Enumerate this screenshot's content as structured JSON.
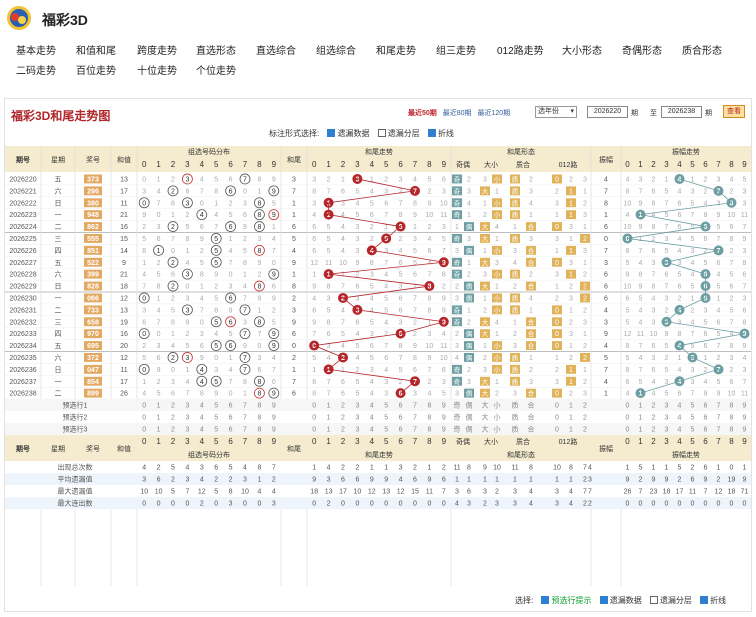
{
  "title": "福彩3D",
  "nav": [
    "基本走势",
    "和值和尾",
    "跨度走势",
    "直选形态",
    "直选综合",
    "组选综合",
    "和尾走势",
    "组三走势",
    "012路走势",
    "大小形态",
    "奇偶形态",
    "质合形态",
    "二码走势",
    "百位走势",
    "十位走势",
    "个位走势"
  ],
  "panel_title": "福彩3D和尾走势图",
  "recent": [
    "最近50期",
    "最近80期",
    "最近120期"
  ],
  "select_value": "选年份",
  "from_value": "2026220",
  "to_value": "2026238",
  "lbl_qi": "期",
  "lbl_zhi": "至",
  "query": "查看",
  "marker_label": "标注形式选择:",
  "opts": [
    "遗漏数据",
    "遗漏分层",
    "折线"
  ],
  "hdr": {
    "qihao": "期号",
    "week": "星期",
    "num": "奖号",
    "sum": "和值",
    "zuxuan": "组选号码分布",
    "hewei": "和尾",
    "hwzs": "和尾走势",
    "hwxt": "和尾形态",
    "jiou": "奇偶",
    "daxiao": "大小",
    "zhihe": "质合",
    "lu": "012路",
    "zhenfu": "振幅",
    "zfzs": "振幅走势",
    "ji": "奇",
    "ou": "偶",
    "da": "大",
    "xiao": "小",
    "zhi": "质",
    "he": "合"
  },
  "rows": [
    {
      "q": "2026220",
      "w": "五",
      "n": "373",
      "s": "13",
      "hw": "3",
      "zf": "4"
    },
    {
      "q": "2026221",
      "w": "六",
      "n": "296",
      "s": "17",
      "hw": "7",
      "zf": "7"
    },
    {
      "q": "2026222",
      "w": "日",
      "n": "380",
      "s": "11",
      "hw": "1",
      "zf": "8"
    },
    {
      "q": "2026223",
      "w": "一",
      "n": "948",
      "s": "21",
      "hw": "1",
      "zf": "1"
    },
    {
      "q": "2026224",
      "w": "二",
      "n": "862",
      "s": "16",
      "hw": "6",
      "zf": "6"
    },
    {
      "q": "2026225",
      "w": "三",
      "n": "555",
      "s": "15",
      "hw": "5",
      "zf": "0"
    },
    {
      "q": "2026226",
      "w": "四",
      "n": "851",
      "s": "14",
      "hw": "4",
      "zf": "7"
    },
    {
      "q": "2026227",
      "w": "五",
      "n": "522",
      "s": "9",
      "hw": "9",
      "zf": "3"
    },
    {
      "q": "2026228",
      "w": "六",
      "n": "399",
      "s": "21",
      "hw": "1",
      "zf": "6"
    },
    {
      "q": "2026229",
      "w": "日",
      "n": "828",
      "s": "18",
      "hw": "8",
      "zf": "6"
    },
    {
      "q": "2026230",
      "w": "一",
      "n": "066",
      "s": "12",
      "hw": "2",
      "zf": "6"
    },
    {
      "q": "2026231",
      "w": "二",
      "n": "733",
      "s": "13",
      "hw": "3",
      "zf": "4"
    },
    {
      "q": "2026232",
      "w": "三",
      "n": "658",
      "s": "19",
      "hw": "9",
      "zf": "3"
    },
    {
      "q": "2026233",
      "w": "四",
      "n": "970",
      "s": "16",
      "hw": "6",
      "zf": "9"
    },
    {
      "q": "2026234",
      "w": "五",
      "n": "695",
      "s": "20",
      "hw": "0",
      "zf": "4"
    },
    {
      "q": "2026235",
      "w": "六",
      "n": "372",
      "s": "12",
      "hw": "2",
      "zf": "5"
    },
    {
      "q": "2026236",
      "w": "日",
      "n": "047",
      "s": "11",
      "hw": "1",
      "zf": "7"
    },
    {
      "q": "2026237",
      "w": "一",
      "n": "854",
      "s": "17",
      "hw": "7",
      "zf": "4"
    },
    {
      "q": "2026238",
      "w": "二",
      "n": "899",
      "s": "26",
      "hw": "6",
      "zf": "1"
    }
  ],
  "yx": [
    "预选行1",
    "预选行2",
    "预选行3"
  ],
  "stats": [
    {
      "label": "出现总次数",
      "z": [
        4,
        2,
        5,
        4,
        3,
        6,
        5,
        4,
        8,
        7
      ],
      "h": [
        1,
        4,
        2,
        2,
        1,
        1,
        3,
        2,
        1,
        2
      ],
      "f": [
        11,
        8,
        9,
        10,
        11,
        8,
        10,
        8,
        7,
        4
      ],
      "zf": [
        1,
        5,
        1,
        1,
        5,
        2,
        6,
        1,
        0,
        1
      ]
    },
    {
      "label": "平均遗漏值",
      "z": [
        3,
        6,
        2,
        3,
        4,
        2,
        2,
        3,
        1,
        2
      ],
      "h": [
        9,
        3,
        6,
        6,
        9,
        9,
        4,
        6,
        9,
        6
      ],
      "f": [
        1,
        1,
        1,
        1,
        1,
        1,
        1,
        1,
        2,
        3
      ],
      "zf": [
        9,
        2,
        9,
        9,
        2,
        6,
        9,
        2,
        19,
        9
      ]
    },
    {
      "label": "最大遗漏值",
      "z": [
        10,
        10,
        5,
        7,
        12,
        5,
        8,
        10,
        4,
        4
      ],
      "h": [
        18,
        13,
        17,
        10,
        12,
        13,
        12,
        15,
        11,
        7
      ],
      "f": [
        3,
        6,
        3,
        2,
        3,
        4,
        3,
        4,
        7,
        7
      ],
      "zf": [
        26,
        7,
        23,
        18,
        17,
        11,
        7,
        12,
        18,
        71
      ]
    },
    {
      "label": "最大连出数",
      "z": [
        0,
        0,
        0,
        0,
        2,
        0,
        3,
        0,
        0,
        3
      ],
      "h": [
        0,
        2,
        0,
        0,
        0,
        0,
        0,
        0,
        0,
        0
      ],
      "f": [
        4,
        3,
        2,
        3,
        3,
        4,
        3,
        4,
        2,
        2
      ],
      "zf": [
        0,
        0,
        0,
        0,
        0,
        0,
        0,
        0,
        0,
        0
      ]
    }
  ],
  "bottom": {
    "label": "选择:",
    "opts": [
      "预选行提示",
      "遗漏数据",
      "遗漏分层",
      "折线"
    ]
  },
  "colors": {
    "red": "#b4262a",
    "orange": "#e3a862",
    "teal": "#6d9ea2",
    "hdrbg": "#f5ecd0"
  }
}
